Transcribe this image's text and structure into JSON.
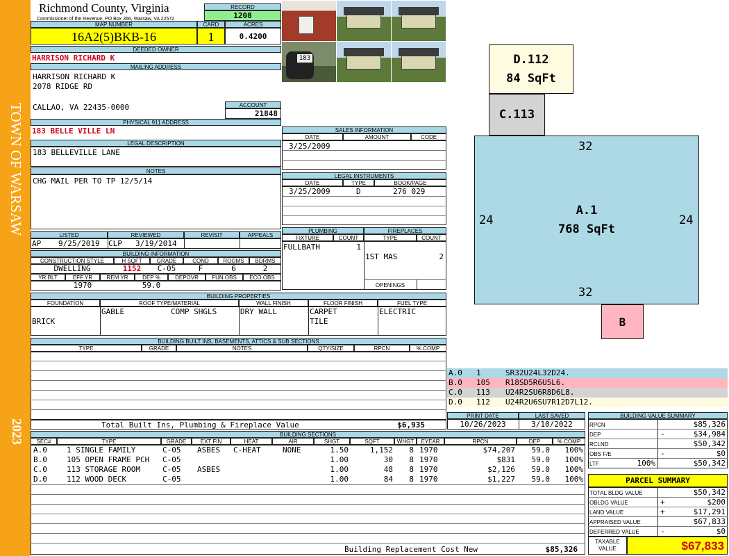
{
  "side": {
    "town": "TOWN OF WARSAW",
    "year": "2023"
  },
  "header": {
    "county": "Richmond County, Virginia",
    "commissioner": "Commissioner of the Revenue, PO Box 366, Warsaw, VA 22572",
    "record_label": "RECORD",
    "record": "1208",
    "map_label": "MAP NUMBER",
    "map": "16A2(5)BKB-16",
    "card_label": "CARD",
    "card": "1",
    "acres_label": "ACRES",
    "acres": "0.4200"
  },
  "owner": {
    "deeded_label": "DEEDED OWNER",
    "deeded": "HARRISON RICHARD K",
    "mailing_label": "MAILING ADDRESS",
    "mail1": "HARRISON RICHARD K",
    "mail2": "2078 RIDGE RD",
    "mail3": "CALLAO, VA 22435-0000",
    "account_label": "ACCOUNT",
    "account": "21848",
    "phys_label": "PHYSICAL 911 ADDRESS",
    "phys": "183 BELLE VILLE LN",
    "legal_label": "LEGAL DESCRIPTION",
    "legal": "183 BELLEVILLE LANE",
    "notes_label": "NOTES",
    "notes": "CHG MAIL PER TO TP 12/5/14"
  },
  "sales": {
    "title": "SALES INFORMATION",
    "h_date": "DATE",
    "h_amount": "AMOUNT",
    "h_code": "CODE",
    "date": "3/25/2009"
  },
  "legal_inst": {
    "title": "LEGAL INSTRUMENTS",
    "h_date": "DATE",
    "h_type": "TYPE",
    "h_book": "BOOK/PAGE",
    "date": "3/25/2009",
    "type": "D",
    "book": "276 029"
  },
  "status": {
    "listed_label": "LISTED",
    "listed_by": "AP",
    "listed": "9/25/2019",
    "reviewed_label": "REVIEWED",
    "reviewed_by": "CLP",
    "reviewed": "3/19/2014",
    "revisit_label": "REVISIT",
    "appeals_label": "APPEALS"
  },
  "building_info": {
    "title": "BUILDING INFORMATION",
    "h_style": "CONSTRUCTION STYLE",
    "h_sqft": "H SQFT",
    "h_grade": "GRADE",
    "h_cond": "COND",
    "h_rooms": "ROOMS",
    "h_bdrms": "BDRMS",
    "style": "DWELLING",
    "sqft": "1152",
    "grade": "C-05",
    "cond": "F",
    "rooms": "6",
    "bdrms": "2",
    "h_yrblt": "YR BLT",
    "h_effyr": "EFF YR",
    "h_remyr": "REM YR",
    "h_dep": "DEP %",
    "h_depovr": "DEPOVR",
    "h_funobs": "FUN OBS",
    "h_ecoobs": "ECO OBS",
    "effyr": "1970",
    "dep": "59.0"
  },
  "plumbing": {
    "title": "PLUMBING",
    "h_fixture": "FIXTURE",
    "h_count": "COUNT",
    "fixture": "FULLBATH",
    "count": "1"
  },
  "fireplaces": {
    "title": "FIREPLACES",
    "h_type": "TYPE",
    "h_count": "COUNT",
    "type": "1ST MAS",
    "count": "2",
    "openings": "OPENINGS"
  },
  "properties": {
    "title": "BUILDING PROPERTIES",
    "h_foundation": "FOUNDATION",
    "h_roof": "ROOF TYPE/MATERIAL",
    "h_wall": "WALL FINISH",
    "h_floor": "FLOOR FINISH",
    "h_fuel": "FUEL TYPE",
    "foundation": "BRICK",
    "roof_type": "GABLE",
    "roof_mat": "COMP SHGLS",
    "wall": "DRY WALL",
    "floor1": "CARPET",
    "floor2": "TILE",
    "fuel": "ELECTRIC"
  },
  "builtins": {
    "title": "BUILDING BUILT INS, BASEMENTS, ATTICS & SUB SECTIONS",
    "h_type": "TYPE",
    "h_grade": "GRADE",
    "h_notes": "NOTES",
    "h_qty": "QTY/SIZE",
    "h_rpcn": "RPCN",
    "h_comp": "% COMP",
    "total_label": "Total Built Ins, Plumbing & Fireplace Value",
    "total": "$6,935"
  },
  "sketch": {
    "areas": [
      {
        "label": "D.112",
        "sub": "84 SqFt",
        "color": "#fffbe0"
      },
      {
        "label": "C.113",
        "sub": "",
        "color": "#d3d3d3"
      },
      {
        "label": "A.1",
        "sub": "768 SqFt",
        "color": "#add8e6"
      },
      {
        "label": "B",
        "sub": "",
        "color": "#ffb6c1"
      }
    ],
    "dims": {
      "top": "32",
      "bottom": "32",
      "left": "24",
      "right": "24"
    },
    "legend": [
      {
        "code": "A.0",
        "num": "1",
        "path": "SR32U24L32D24.",
        "color": "#add8e6"
      },
      {
        "code": "B.0",
        "num": "105",
        "path": "R18SD5R6U5L6.",
        "color": "#ffb6c1"
      },
      {
        "code": "C.0",
        "num": "113",
        "path": "U24R2SU6R8D6L8.",
        "color": "#d3d3d3"
      },
      {
        "code": "D.0",
        "num": "112",
        "path": "U24R2U6SU7R12D7L12.",
        "color": "#fffbe0"
      }
    ]
  },
  "dates": {
    "print_label": "PRINT DATE",
    "print": "10/26/2023",
    "saved_label": "LAST SAVED",
    "saved": "3/10/2022"
  },
  "sections": {
    "title": "BUILDING SECTIONS",
    "headers": [
      "SEC#",
      "TYPE",
      "GRADE",
      "EXT FIN",
      "HEAT",
      "AIR",
      "SHGT",
      "SQFT",
      "WHGT",
      "EYEAR",
      "RPCN",
      "DEP",
      "% COMP"
    ],
    "rows": [
      [
        "A.0",
        "1 SINGLE FAMILY",
        "C-05",
        "ASBES",
        "C-HEAT",
        "NONE",
        "1.50",
        "1,152",
        "8",
        "1970",
        "$74,207",
        "59.0",
        "100%"
      ],
      [
        "B.0",
        "105 OPEN FRAME PCH",
        "C-05",
        "",
        "",
        "",
        "1.00",
        "30",
        "8",
        "1970",
        "$831",
        "59.0",
        "100%"
      ],
      [
        "C.0",
        "113 STORAGE ROOM",
        "C-05",
        "ASBES",
        "",
        "",
        "1.00",
        "48",
        "8",
        "1970",
        "$2,126",
        "59.0",
        "100%"
      ],
      [
        "D.0",
        "112 WOOD DECK",
        "C-05",
        "",
        "",
        "",
        "1.00",
        "84",
        "8",
        "1970",
        "$1,227",
        "59.0",
        "100%"
      ]
    ],
    "total_label": "Building Replacement Cost New",
    "total": "$85,326"
  },
  "value_summary": {
    "title": "BUILDING VALUE SUMMARY",
    "rows": [
      {
        "label": "RPCN",
        "sign": "",
        "pct": "",
        "value": "$85,326"
      },
      {
        "label": "DEP",
        "sign": "-",
        "pct": "",
        "value": "$34,984"
      },
      {
        "label": "RCLND",
        "sign": "",
        "pct": "",
        "value": "$50,342"
      },
      {
        "label": "OBS F/E",
        "sign": "-",
        "pct": "",
        "value": "$0"
      },
      {
        "label": "LTF",
        "sign": "",
        "pct": "100%",
        "value": "$50,342"
      }
    ]
  },
  "parcel_summary": {
    "title": "PARCEL SUMMARY",
    "rows": [
      {
        "label": "TOTAL BLDG VALUE",
        "sign": "",
        "value": "$50,342"
      },
      {
        "label": "OBLDG VALUE",
        "sign": "+",
        "value": "$200"
      },
      {
        "label": "LAND VALUE",
        "sign": "+",
        "value": "$17,291"
      },
      {
        "label": "APPRAISED VALUE",
        "sign": "",
        "value": "$67,833"
      },
      {
        "label": "DEFERRED VALUE",
        "sign": "-",
        "value": "$0"
      }
    ],
    "taxable_label1": "TAXABLE",
    "taxable_label2": "VALUE",
    "taxable": "$67,833"
  }
}
